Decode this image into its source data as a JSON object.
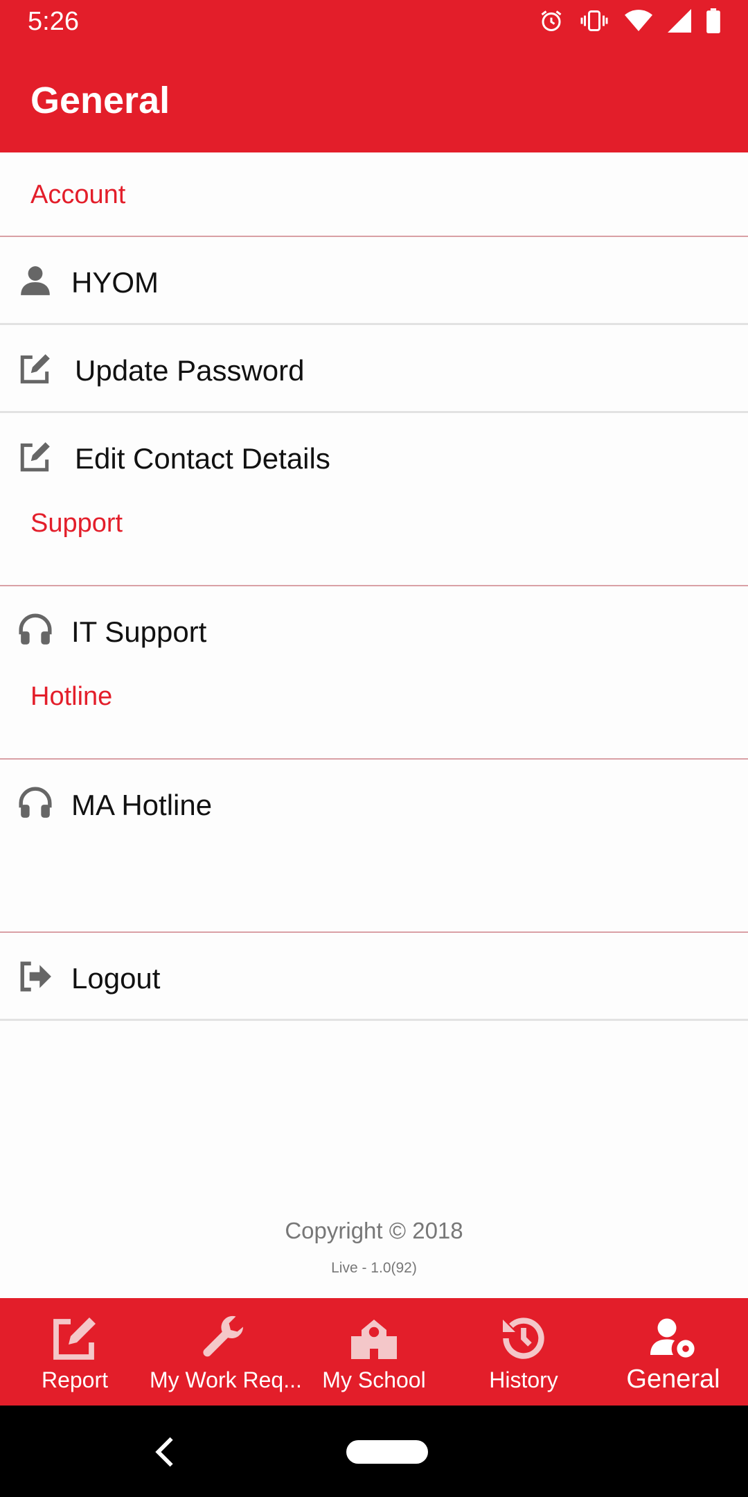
{
  "status_bar": {
    "time": "5:26",
    "icons": [
      "alarm-icon",
      "vibrate-icon",
      "wifi-icon",
      "signal-icon",
      "battery-icon"
    ]
  },
  "app_bar": {
    "title": "General"
  },
  "sections": {
    "account": "Account",
    "support": "Support",
    "hotline": "Hotline"
  },
  "items": {
    "user": "HYOM",
    "update_password": "Update Password",
    "edit_contact": "Edit Contact Details",
    "it_support": "IT Support",
    "ma_hotline": "MA Hotline",
    "logout": "Logout"
  },
  "footer": {
    "copyright": "Copyright © 2018",
    "version": "Live - 1.0(92)"
  },
  "bottom_nav": {
    "report": "Report",
    "work_requests": "My Work Req...",
    "my_school": "My School",
    "history": "History",
    "general": "General",
    "active": "general"
  },
  "colors": {
    "brand": "#e31e2a",
    "section_text": "#e31e2a",
    "icon_gray": "#666666"
  }
}
